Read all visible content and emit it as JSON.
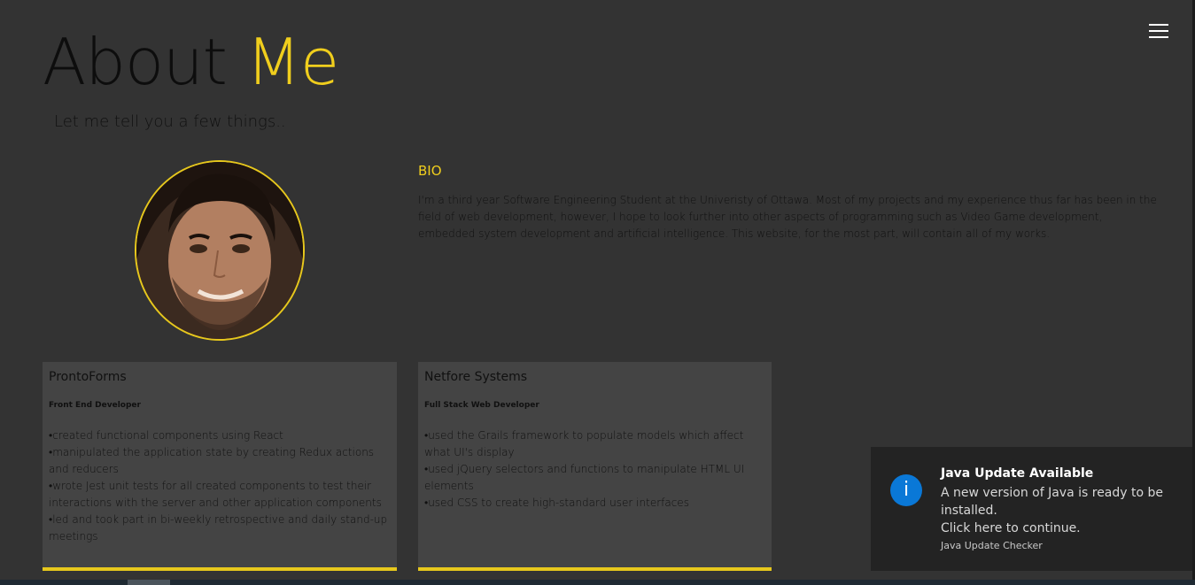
{
  "header": {
    "title_part1": "About ",
    "title_part2": "Me",
    "subtitle": "Let me tell you a few things.."
  },
  "menu": {
    "icon": "hamburger-menu-icon"
  },
  "profile": {
    "photo": "profile-photo"
  },
  "bio": {
    "heading": "BIO",
    "text": "I'm a third year Software Engineering Student at the Univeristy of Ottawa. Most of my projects and my experience thus far has been in the field of web development, however, I hope to look further into other aspects of programming such as Video Game development, embedded system development and artificial intelligence. This website, for the most part, will contain all of my works."
  },
  "experience": [
    {
      "company": "ProntoForms",
      "role": "Front End Developer",
      "points": [
        "•created functional components using React",
        "•manipulated the application state by creating Redux actions and reducers",
        "•wrote Jest unit tests for all created components to test their interactions with the server and other application components",
        "•led and took part in bi-weekly retrospective and daily stand-up meetings"
      ]
    },
    {
      "company": "Netfore Systems",
      "role": "Full Stack Web Developer",
      "points": [
        "•used the Grails framework to populate models which affect what UI's display",
        "•used jQuery selectors and functions to manipulate HTML UI elements",
        "•used CSS to create high-standard user interfaces"
      ]
    }
  ],
  "notification": {
    "icon": "info-icon",
    "title": "Java Update Available",
    "message_line1": "A new version of Java is ready to be installed.",
    "message_line2": "Click here to continue.",
    "source": "Java Update Checker"
  },
  "colors": {
    "background": "#333333",
    "accent": "#f0ce1d",
    "card": "#444444",
    "toast": "#232323",
    "info_blue": "#0a78d7"
  }
}
